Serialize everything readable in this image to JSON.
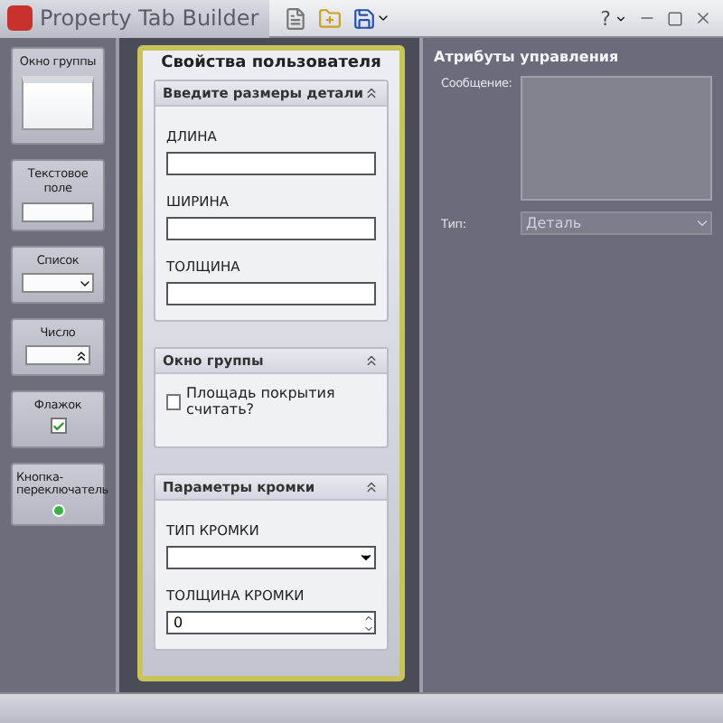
{
  "window": {
    "title": "Property Tab Builder",
    "help": "?"
  },
  "palette": [
    {
      "kind": "groupbox",
      "label": "Окно группы"
    },
    {
      "kind": "textbox",
      "label": "Текстовое поле"
    },
    {
      "kind": "combo",
      "label": "Список"
    },
    {
      "kind": "number",
      "label": "Число"
    },
    {
      "kind": "checkbox",
      "label": "Флажок",
      "checked": true
    },
    {
      "kind": "radio",
      "label": "Кнопка-переключатель",
      "selected": true
    }
  ],
  "property_page": {
    "title": "Свойства пользователя",
    "groups": [
      {
        "title": "Введите размеры детали",
        "expanded": true,
        "controls": [
          {
            "kind": "text",
            "label": "ДЛИНА"
          },
          {
            "kind": "text",
            "label": "ШИРИНА"
          },
          {
            "kind": "text",
            "label": "ТОЛЩИНА"
          }
        ]
      },
      {
        "title": "Окно группы",
        "expanded": true,
        "controls": [
          {
            "kind": "checkbox",
            "label": "Площадь покрытия считать?",
            "checked": false
          }
        ]
      },
      {
        "title": "Параметры кромки",
        "expanded": true,
        "controls": [
          {
            "kind": "combo",
            "label": "ТИП КРОМКИ"
          },
          {
            "kind": "number",
            "label": "ТОЛЩИНА КРОМКИ",
            "value": "0"
          }
        ]
      }
    ]
  },
  "attributes": {
    "title": "Атрибуты управления",
    "message_label": "Сообщение:",
    "type_label": "Тип:",
    "type_value": "Деталь"
  }
}
